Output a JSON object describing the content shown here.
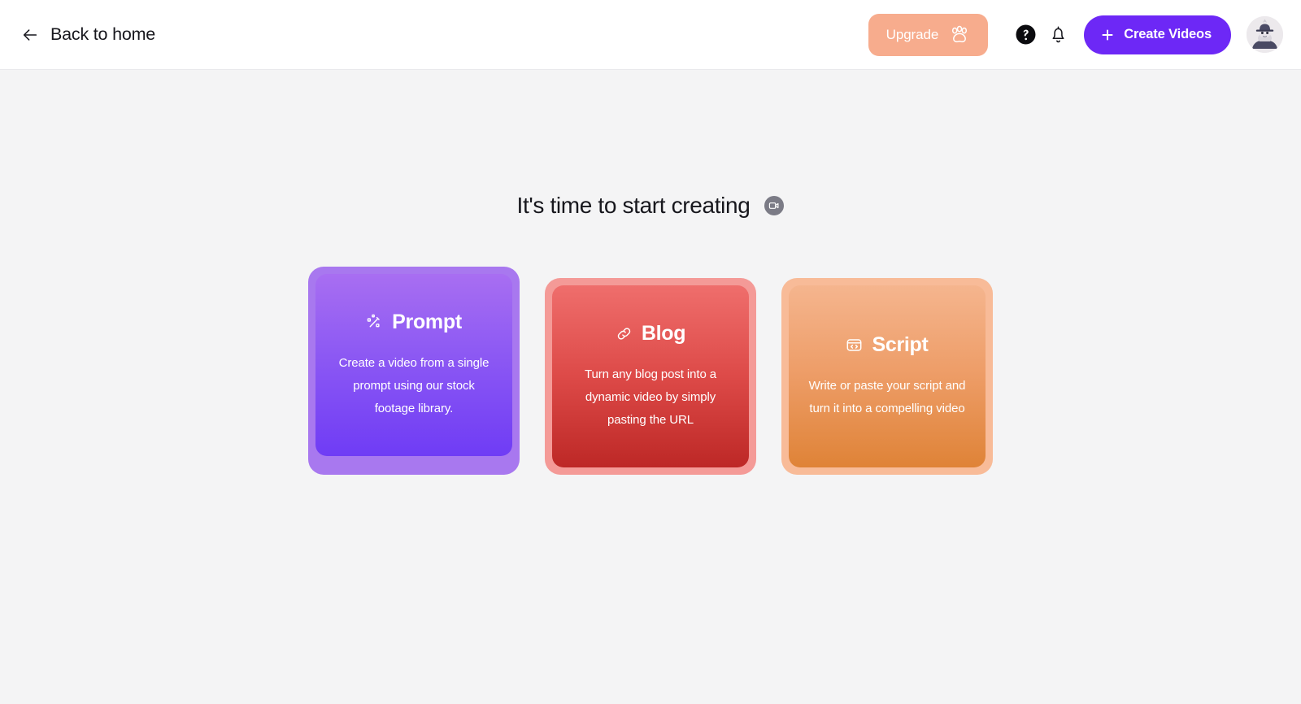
{
  "header": {
    "back": {
      "label": "Back to home",
      "icon": "arrow-left-icon"
    },
    "upgrade": {
      "label": "Upgrade",
      "icon": "paw-icon",
      "color": "#f7ac8d"
    },
    "help": {
      "icon": "help-circle-icon"
    },
    "notifications": {
      "icon": "bell-icon"
    },
    "create": {
      "label": "Create Videos",
      "icon": "plus-icon",
      "color": "#6d28f6"
    },
    "avatar": {
      "icon": "user-avatar"
    }
  },
  "main": {
    "headline": "It's time to start creating",
    "headline_badge_icon": "video-camera-icon",
    "cards": [
      {
        "title": "Prompt",
        "icon": "magic-wand-icon",
        "description": "Create a video from a single prompt using our stock footage library.",
        "frame_color": "#a878ef",
        "accent": "purple"
      },
      {
        "title": "Blog",
        "icon": "link-icon",
        "description": "Turn any blog post into a dynamic video by simply pasting the URL",
        "frame_color": "#f49a97",
        "accent": "red"
      },
      {
        "title": "Script",
        "icon": "code-window-icon",
        "description": "Write or paste your script and turn it into a compelling video",
        "frame_color": "#f8bb98",
        "accent": "orange"
      }
    ]
  }
}
